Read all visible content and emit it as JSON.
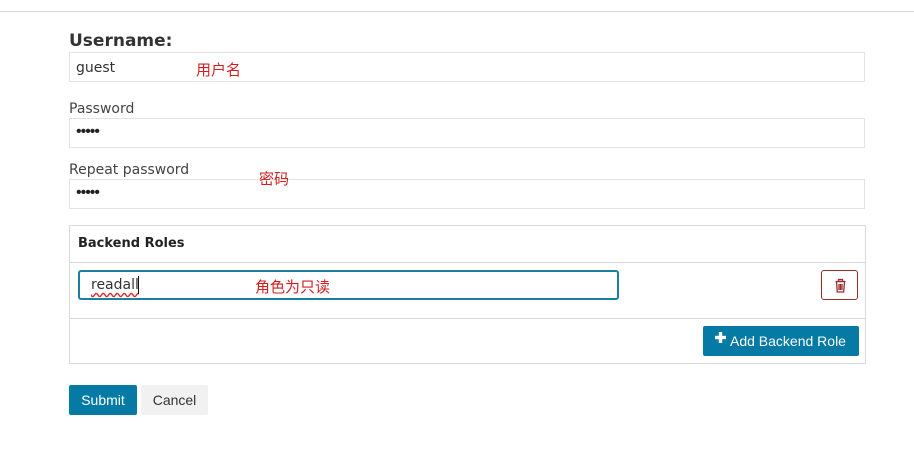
{
  "form": {
    "username_label": "Username:",
    "username_value": "guest",
    "password_label": "Password",
    "password_value": "•••••",
    "repeat_password_label": "Repeat password",
    "repeat_password_value": "•••••"
  },
  "annotations": {
    "username": "用户名",
    "password": "密码",
    "role": "角色为只读"
  },
  "backend_roles": {
    "title": "Backend Roles",
    "roles": [
      {
        "value": "readall"
      }
    ],
    "add_label": "Add Backend Role",
    "delete_icon": "trash-icon",
    "add_icon": "plus-icon"
  },
  "actions": {
    "submit_label": "Submit",
    "cancel_label": "Cancel"
  },
  "colors": {
    "primary": "#057aa4",
    "danger": "#9b2b2b",
    "annotation": "#d21f1f"
  }
}
